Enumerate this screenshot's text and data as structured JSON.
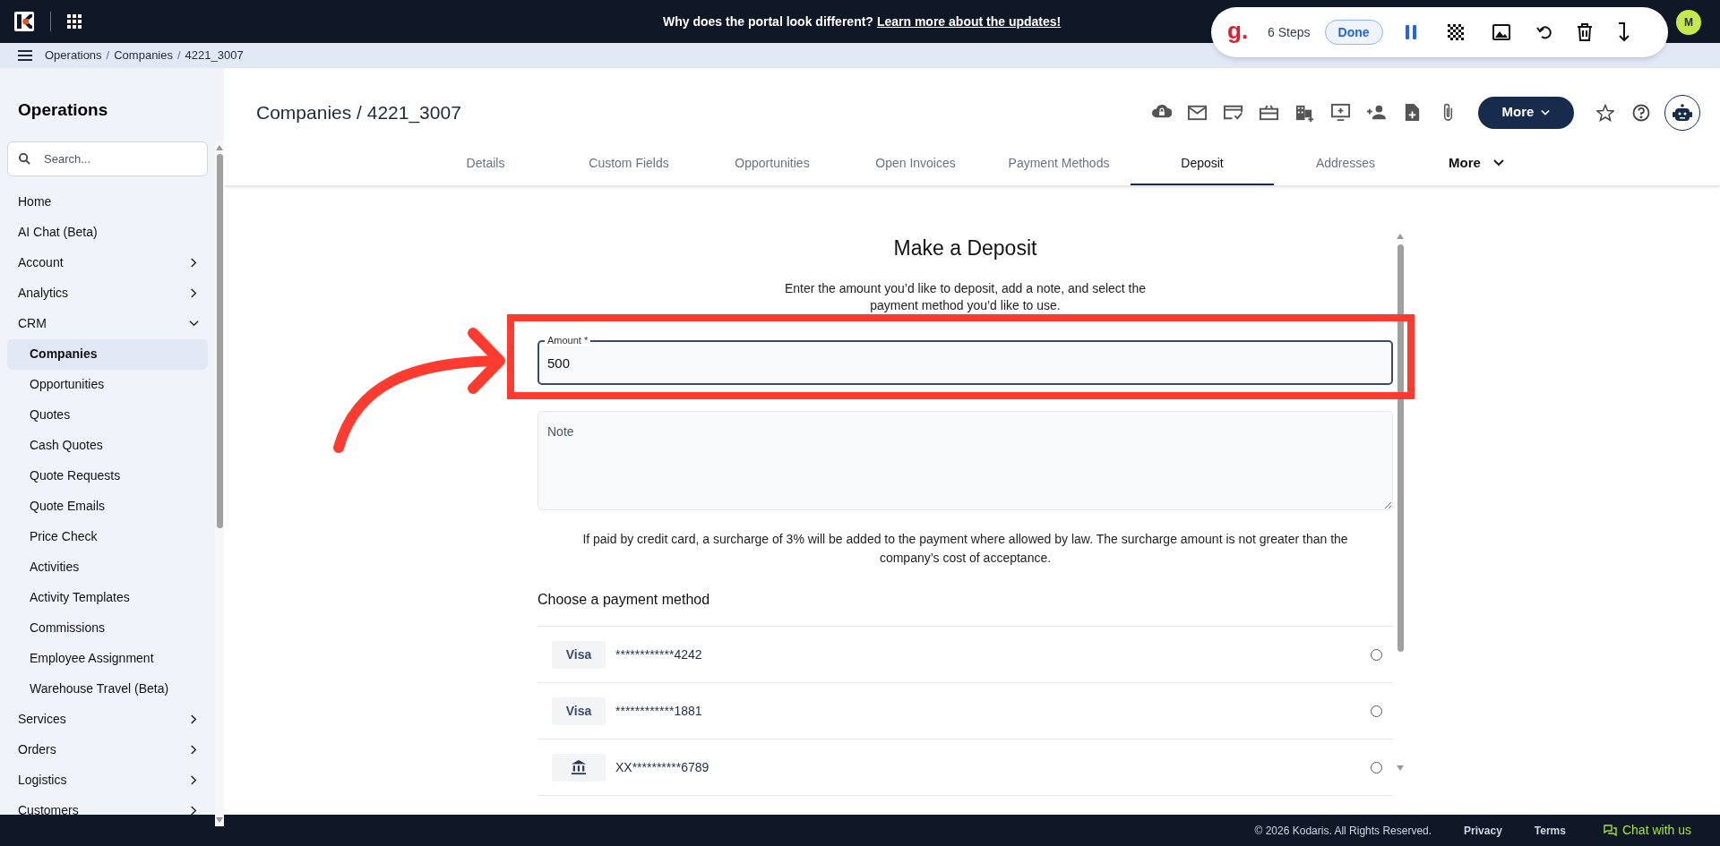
{
  "banner": {
    "text": "Why does the portal look different?",
    "link": "Learn more about the updates!"
  },
  "recorder": {
    "logo": "g.",
    "steps": "6 Steps",
    "done": "Done"
  },
  "user": {
    "initial": "M"
  },
  "breadcrumb": {
    "separator": "/",
    "items": [
      "Operations",
      "Companies",
      "4221_3007"
    ]
  },
  "sidebar": {
    "title": "Operations",
    "search_placeholder": "Search...",
    "items": [
      {
        "label": "Home",
        "kind": "link",
        "selected": false
      },
      {
        "label": "AI Chat (Beta)",
        "kind": "link",
        "selected": false
      },
      {
        "label": "Account",
        "kind": "group",
        "expanded": false,
        "selected": false
      },
      {
        "label": "Analytics",
        "kind": "group",
        "expanded": false,
        "selected": false
      },
      {
        "label": "CRM",
        "kind": "group",
        "expanded": true,
        "selected": false,
        "children": [
          {
            "label": "Companies",
            "selected": true
          },
          {
            "label": "Opportunities",
            "selected": false
          },
          {
            "label": "Quotes",
            "selected": false
          },
          {
            "label": "Cash Quotes",
            "selected": false
          },
          {
            "label": "Quote Requests",
            "selected": false
          },
          {
            "label": "Quote Emails",
            "selected": false
          },
          {
            "label": "Price Check",
            "selected": false
          },
          {
            "label": "Activities",
            "selected": false
          },
          {
            "label": "Activity Templates",
            "selected": false
          },
          {
            "label": "Commissions",
            "selected": false
          },
          {
            "label": "Employee Assignment",
            "selected": false
          },
          {
            "label": "Warehouse Travel (Beta)",
            "selected": false
          }
        ]
      },
      {
        "label": "Services",
        "kind": "group",
        "expanded": false,
        "selected": false
      },
      {
        "label": "Orders",
        "kind": "group",
        "expanded": false,
        "selected": false
      },
      {
        "label": "Logistics",
        "kind": "group",
        "expanded": false,
        "selected": false
      },
      {
        "label": "Customers",
        "kind": "group",
        "expanded": false,
        "selected": false
      }
    ]
  },
  "page_title": "Companies / 4221_3007",
  "more_button": "More",
  "tabs": [
    {
      "label": "Details",
      "selected": false
    },
    {
      "label": "Custom Fields",
      "selected": false
    },
    {
      "label": "Opportunities",
      "selected": false
    },
    {
      "label": "Open Invoices",
      "selected": false
    },
    {
      "label": "Payment Methods",
      "selected": false
    },
    {
      "label": "Deposit",
      "selected": true
    },
    {
      "label": "Addresses",
      "selected": false
    },
    {
      "label": "More",
      "selected": false,
      "kind": "menu"
    }
  ],
  "form": {
    "title": "Make a Deposit",
    "description": "Enter the amount you’d like to deposit, add a note, and select the payment method you’d like to use.",
    "amount": {
      "label": "Amount *",
      "value": "500",
      "focused": true
    },
    "note": {
      "placeholder": "Note"
    },
    "surcharge": "If paid by credit card, a surcharge of 3% will be added to the payment where allowed by law. The surcharge amount is not greater than the company’s cost of acceptance.",
    "payment_heading": "Choose a payment method",
    "payment_methods": [
      {
        "kind": "card",
        "brand": "Visa",
        "number": "************4242",
        "selected": false
      },
      {
        "kind": "card",
        "brand": "Visa",
        "number": "************1881",
        "selected": false
      },
      {
        "kind": "bank",
        "number": "XX**********6789",
        "selected": false
      }
    ]
  },
  "footer": {
    "copyright": "© 2026 Kodaris. All Rights Reserved.",
    "links": [
      "Privacy",
      "Terms"
    ],
    "chat": "Chat with us"
  }
}
